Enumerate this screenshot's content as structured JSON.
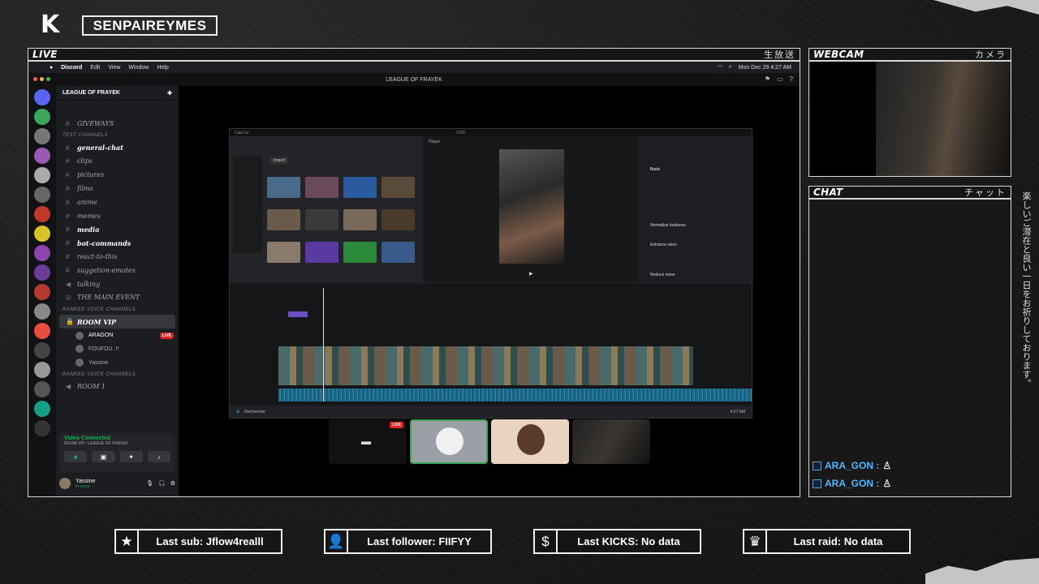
{
  "channel": {
    "name": "SENPAIREYMES",
    "logo": "K"
  },
  "live_panel": {
    "title": "LIVE",
    "jp": "生放送"
  },
  "webcam_panel": {
    "title": "WEBCAM",
    "jp": "カメラ"
  },
  "chat_panel": {
    "title": "CHAT",
    "jp": "チャット",
    "messages": [
      {
        "user": "ARA_GON :",
        "icon": "kick-badge-icon"
      },
      {
        "user": "ARA_GON :",
        "icon": "kick-badge-icon"
      }
    ]
  },
  "vertical_jp": "楽しいご滞在と良い一日をお祈りしております。",
  "mac_menubar": {
    "apple": "",
    "items": [
      "Discord",
      "Edit",
      "View",
      "Window",
      "Help"
    ],
    "clock": "Mon Dec 29  4:27 AM"
  },
  "discord": {
    "window_title": "LEAGUE OF FRAYEK",
    "guild_name": "LEAGUE OF FRAYEK",
    "channels": [
      {
        "name": "GIVEWAYS",
        "type": "text",
        "highlight": false
      },
      {
        "category": "TEXT CHANNELS"
      },
      {
        "name": "general-chat",
        "type": "text",
        "highlight": true
      },
      {
        "name": "clips",
        "type": "text",
        "highlight": false
      },
      {
        "name": "pictures",
        "type": "text",
        "highlight": false
      },
      {
        "name": "films",
        "type": "text",
        "highlight": false
      },
      {
        "name": "anime",
        "type": "text",
        "highlight": false
      },
      {
        "name": "memes",
        "type": "text",
        "highlight": false
      },
      {
        "name": "media",
        "type": "text",
        "highlight": true
      },
      {
        "name": "bot-commands",
        "type": "text",
        "highlight": true
      },
      {
        "name": "react-to-this",
        "type": "text",
        "highlight": false
      },
      {
        "name": "suggetion-emotes",
        "type": "text",
        "highlight": false
      },
      {
        "name": "talking",
        "type": "voice",
        "highlight": false
      },
      {
        "name": "THE MAIN EVENT",
        "type": "stage",
        "highlight": false
      },
      {
        "category": "RANKED VOICE CHANNELS"
      },
      {
        "name": "ROOM VIP",
        "type": "voice",
        "selected": true
      }
    ],
    "voice_users": [
      {
        "name": "ARAGON",
        "live": "LIVE"
      },
      {
        "name": "FOUFOU..!!",
        "live": ""
      },
      {
        "name": "Yassine",
        "live": ""
      }
    ],
    "category2": "RANKED VOICE CHANNELS",
    "room1": "ROOM 1",
    "voice_connected": "Video Connected",
    "voice_sub": "ROOM VIP / LEAGUE OF FRAYEK",
    "user": {
      "name": "Yassine",
      "status": "In voice"
    }
  },
  "editor": {
    "app": "CapCut",
    "import": "Import",
    "player": "Player",
    "timecode": "1325",
    "basic": "Basic",
    "normalize": "Normalize loudness",
    "enhance": "Enhance voice",
    "reduce": "Reduce noise",
    "taskbar_search": "Rechercher",
    "taskbar_time": "4:27 AM"
  },
  "tiles": [
    {
      "kind": "screen",
      "live": "LIVE"
    },
    {
      "kind": "avatar"
    },
    {
      "kind": "avatar-girl"
    },
    {
      "kind": "cam"
    }
  ],
  "stats": [
    {
      "icon": "star-icon",
      "glyph": "★",
      "label": "Last sub: Jflow4realll"
    },
    {
      "icon": "add-user-icon",
      "glyph": "👤",
      "label": "Last follower: FIIFYY"
    },
    {
      "icon": "dollar-icon",
      "glyph": "$",
      "label": "Last KICKS: No data"
    },
    {
      "icon": "crown-icon",
      "glyph": "♛",
      "label": "Last raid: No data"
    }
  ]
}
